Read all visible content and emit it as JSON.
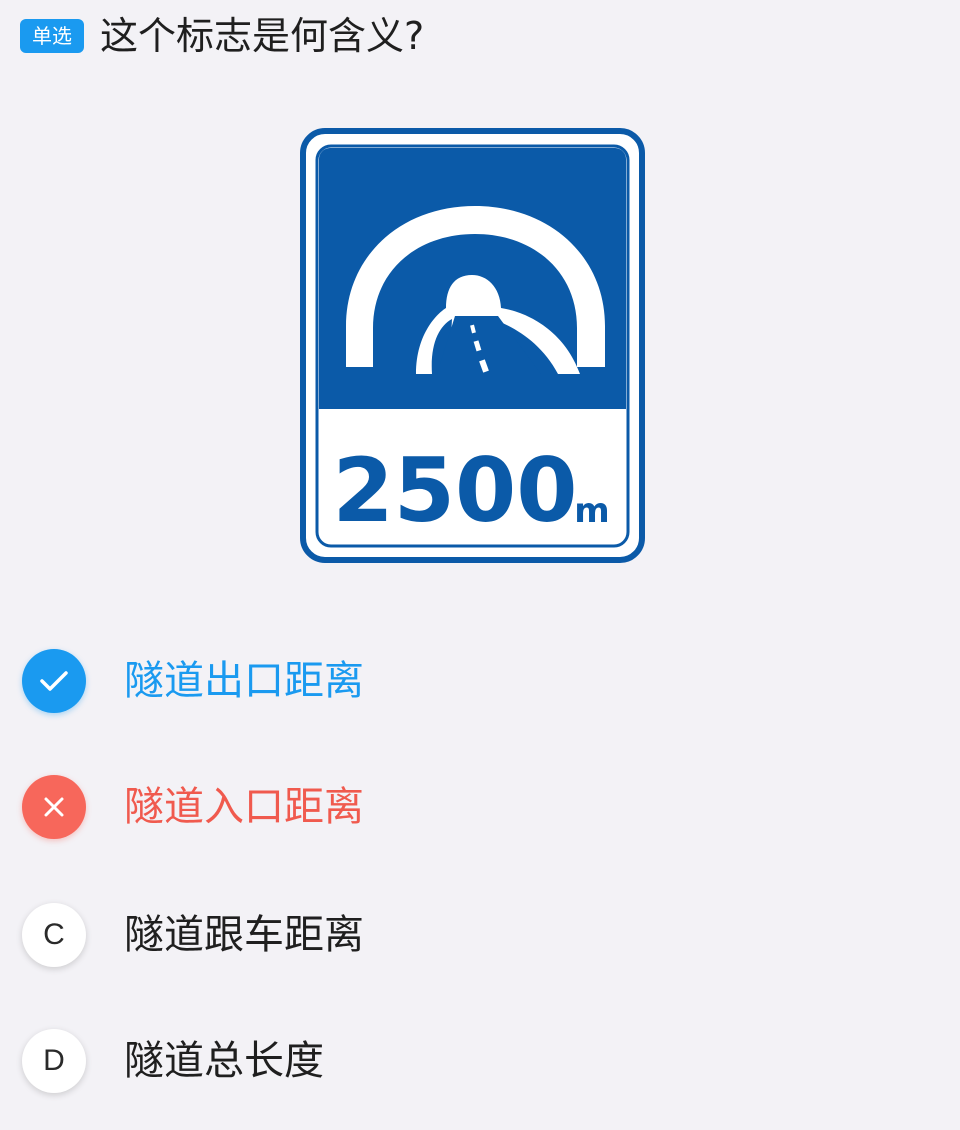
{
  "question": {
    "type_badge": "单选",
    "text": "这个标志是何含义?"
  },
  "sign": {
    "distance_number": "2500",
    "distance_unit": "m",
    "sign_color": "#0b5aa8",
    "background_color": "#ffffff"
  },
  "options": [
    {
      "marker": "check-icon",
      "label": "隧道出口距离",
      "state": "correct",
      "color": "#1a9af0"
    },
    {
      "marker": "cross-icon",
      "label": "隧道入口距离",
      "state": "wrong",
      "color": "#f05a4e"
    },
    {
      "marker": "C",
      "label": "隧道跟车距离",
      "state": "unselected"
    },
    {
      "marker": "D",
      "label": "隧道总长度",
      "state": "unselected"
    }
  ]
}
